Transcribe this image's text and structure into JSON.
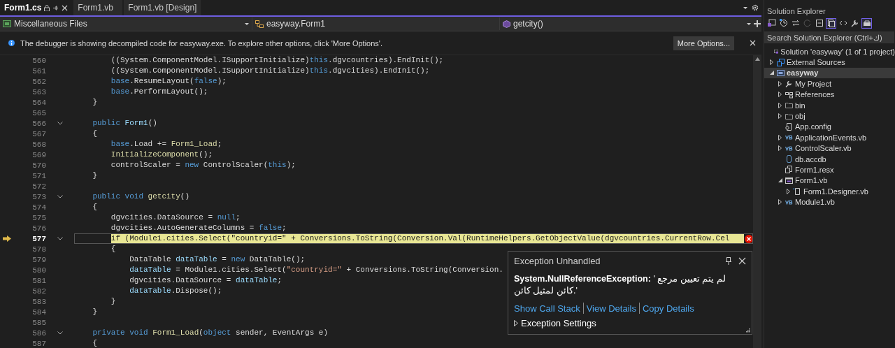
{
  "tabs": [
    {
      "label": "Form1.cs",
      "selected": true
    },
    {
      "label": "Form1.vb",
      "selected": false
    },
    {
      "label": "Form1.vb [Design]",
      "selected": false
    }
  ],
  "navigation_bar": {
    "project": "Miscellaneous Files",
    "type": "easyway.Form1",
    "member": "getcity()"
  },
  "info_bar": {
    "message": "The debugger is showing decompiled code for easyway.exe. To explore other options, click 'More Options'.",
    "button": "More Options..."
  },
  "editor": {
    "lines": [
      {
        "number": "560",
        "fold": false,
        "current": false,
        "error": false,
        "segments": [
          {
            "kind": "plain",
            "text": "        ((System.ComponentModel.ISupportInitialize)"
          },
          {
            "kind": "keyword",
            "text": "this"
          },
          {
            "kind": "plain",
            "text": ".dgvcountries).EndInit();"
          }
        ]
      },
      {
        "number": "561",
        "fold": false,
        "current": false,
        "error": false,
        "segments": [
          {
            "kind": "plain",
            "text": "        ((System.ComponentModel.ISupportInitialize)"
          },
          {
            "kind": "keyword",
            "text": "this"
          },
          {
            "kind": "plain",
            "text": ".dgvcities).EndInit();"
          }
        ]
      },
      {
        "number": "562",
        "fold": false,
        "current": false,
        "error": false,
        "segments": [
          {
            "kind": "keyword",
            "text": "        base"
          },
          {
            "kind": "plain",
            "text": ".ResumeLayout("
          },
          {
            "kind": "keyword",
            "text": "false"
          },
          {
            "kind": "plain",
            "text": ");"
          }
        ]
      },
      {
        "number": "563",
        "fold": false,
        "current": false,
        "error": false,
        "segments": [
          {
            "kind": "keyword",
            "text": "        base"
          },
          {
            "kind": "plain",
            "text": ".PerformLayout();"
          }
        ]
      },
      {
        "number": "564",
        "fold": false,
        "current": false,
        "error": false,
        "segments": [
          {
            "kind": "plain",
            "text": "    }"
          }
        ]
      },
      {
        "number": "565",
        "fold": false,
        "current": false,
        "error": false
      },
      {
        "number": "566",
        "fold": true,
        "current": false,
        "error": false,
        "segments": [
          {
            "kind": "keyword",
            "text": "    public "
          },
          {
            "kind": "local",
            "text": "Form1"
          },
          {
            "kind": "plain",
            "text": "()"
          }
        ]
      },
      {
        "number": "567",
        "fold": false,
        "current": false,
        "error": false,
        "segments": [
          {
            "kind": "plain",
            "text": "    {"
          }
        ]
      },
      {
        "number": "568",
        "fold": false,
        "current": false,
        "error": false,
        "segments": [
          {
            "kind": "keyword",
            "text": "        base"
          },
          {
            "kind": "plain",
            "text": ".Load += "
          },
          {
            "kind": "method",
            "text": "Form1_Load"
          },
          {
            "kind": "plain",
            "text": ";"
          }
        ]
      },
      {
        "number": "569",
        "fold": false,
        "current": false,
        "error": false,
        "segments": [
          {
            "kind": "method",
            "text": "        InitializeComponent"
          },
          {
            "kind": "plain",
            "text": "();"
          }
        ]
      },
      {
        "number": "570",
        "fold": false,
        "current": false,
        "error": false,
        "segments": [
          {
            "kind": "plain",
            "text": "        controlScaler = "
          },
          {
            "kind": "keyword",
            "text": "new"
          },
          {
            "kind": "plain",
            "text": " ControlScaler("
          },
          {
            "kind": "keyword",
            "text": "this"
          },
          {
            "kind": "plain",
            "text": ");"
          }
        ]
      },
      {
        "number": "571",
        "fold": false,
        "current": false,
        "error": false,
        "segments": [
          {
            "kind": "plain",
            "text": "    }"
          }
        ]
      },
      {
        "number": "572",
        "fold": false,
        "current": false,
        "error": false
      },
      {
        "number": "573",
        "fold": true,
        "current": false,
        "error": false,
        "segments": [
          {
            "kind": "keyword",
            "text": "    public void "
          },
          {
            "kind": "method",
            "text": "getcity"
          },
          {
            "kind": "plain",
            "text": "()"
          }
        ]
      },
      {
        "number": "574",
        "fold": false,
        "current": false,
        "error": false,
        "segments": [
          {
            "kind": "plain",
            "text": "    {"
          }
        ]
      },
      {
        "number": "575",
        "fold": false,
        "current": false,
        "error": false,
        "segments": [
          {
            "kind": "plain",
            "text": "        dgvcities.DataSource = "
          },
          {
            "kind": "keyword",
            "text": "null"
          },
          {
            "kind": "plain",
            "text": ";"
          }
        ]
      },
      {
        "number": "576",
        "fold": false,
        "current": false,
        "error": false,
        "segments": [
          {
            "kind": "plain",
            "text": "        dgvcities.AutoGenerateColumns = "
          },
          {
            "kind": "keyword",
            "text": "false"
          },
          {
            "kind": "plain",
            "text": ";"
          }
        ]
      },
      {
        "number": "577",
        "fold": true,
        "current": true,
        "error": true,
        "segments": [
          {
            "kind": "plain",
            "text": "        if (Module1.cities.Select(\"countryid=\" + Conversions.ToString(Conversion.Val(RuntimeHelpers.GetObjectValue(dgvcountries.CurrentRow.Cel"
          }
        ]
      },
      {
        "number": "578",
        "fold": false,
        "current": false,
        "error": false,
        "segments": [
          {
            "kind": "plain",
            "text": "        {"
          }
        ]
      },
      {
        "number": "579",
        "fold": false,
        "current": false,
        "error": false,
        "segments": [
          {
            "kind": "plain",
            "text": "            DataTable "
          },
          {
            "kind": "local",
            "text": "dataTable"
          },
          {
            "kind": "plain",
            "text": " = "
          },
          {
            "kind": "keyword",
            "text": "new"
          },
          {
            "kind": "plain",
            "text": " DataTable();"
          }
        ]
      },
      {
        "number": "580",
        "fold": false,
        "current": false,
        "error": false,
        "segments": [
          {
            "kind": "local",
            "text": "            dataTable"
          },
          {
            "kind": "plain",
            "text": " = Module1.cities.Select("
          },
          {
            "kind": "string",
            "text": "\"countryid=\""
          },
          {
            "kind": "plain",
            "text": " + Conversions.ToString(Conversion."
          }
        ]
      },
      {
        "number": "581",
        "fold": false,
        "current": false,
        "error": false,
        "segments": [
          {
            "kind": "plain",
            "text": "            dgvcities.DataSource = "
          },
          {
            "kind": "local",
            "text": "dataTable"
          },
          {
            "kind": "plain",
            "text": ";"
          }
        ]
      },
      {
        "number": "582",
        "fold": false,
        "current": false,
        "error": false,
        "segments": [
          {
            "kind": "local",
            "text": "            dataTable"
          },
          {
            "kind": "plain",
            "text": ".Dispose();"
          }
        ]
      },
      {
        "number": "583",
        "fold": false,
        "current": false,
        "error": false,
        "segments": [
          {
            "kind": "plain",
            "text": "        }"
          }
        ]
      },
      {
        "number": "584",
        "fold": false,
        "current": false,
        "error": false,
        "segments": [
          {
            "kind": "plain",
            "text": "    }"
          }
        ]
      },
      {
        "number": "585",
        "fold": false,
        "current": false,
        "error": false
      },
      {
        "number": "586",
        "fold": true,
        "current": false,
        "error": false,
        "segments": [
          {
            "kind": "keyword",
            "text": "    private void "
          },
          {
            "kind": "method",
            "text": "Form1_Load"
          },
          {
            "kind": "plain",
            "text": "("
          },
          {
            "kind": "keyword",
            "text": "object"
          },
          {
            "kind": "plain",
            "text": " sender, EventArgs e)"
          }
        ]
      },
      {
        "number": "587",
        "fold": false,
        "current": false,
        "error": false,
        "segments": [
          {
            "kind": "plain",
            "text": "    {"
          }
        ]
      }
    ]
  },
  "exception": {
    "title": "Exception Unhandled",
    "message": "**System.NullReferenceException:** ' لم يتم تعيين مرجع كائن لمثيل كائن.'",
    "links": [
      "Show Call Stack",
      "View Details",
      "Copy Details"
    ],
    "settings": "Exception Settings"
  },
  "solution_explorer": {
    "title": "Solution Explorer",
    "toolbar": [
      {
        "kind": "solution",
        "on": false
      },
      {
        "kind": "history",
        "on": false
      },
      {
        "kind": "sync",
        "on": false
      },
      {
        "kind": "refresh",
        "on": false
      },
      {
        "kind": "collapse",
        "on": false
      },
      {
        "kind": "files",
        "on": true
      },
      {
        "kind": "code",
        "on": false
      },
      {
        "kind": "wrench",
        "on": false
      },
      {
        "kind": "preview",
        "on": true
      }
    ],
    "search": {
      "placeholder": "Search Solution Explorer (Ctrl+ك)"
    },
    "tree": [
      {
        "label": "Solution 'easyway' (1 of 1 project)",
        "kind": "solution",
        "expandable": false,
        "selected": false
      },
      {
        "label": "External Sources",
        "kind": "external",
        "expandable": true,
        "expanded": false,
        "selected": false
      },
      {
        "label": "easyway",
        "kind": "project",
        "expandable": true,
        "expanded": true,
        "selected": true,
        "children": [
          {
            "label": "My Project",
            "kind": "wrench",
            "expandable": true,
            "expanded": false,
            "selected": false
          },
          {
            "label": "References",
            "kind": "references",
            "expandable": true,
            "expanded": false,
            "selected": false
          },
          {
            "label": "bin",
            "kind": "folder",
            "expandable": true,
            "expanded": false,
            "selected": false
          },
          {
            "label": "obj",
            "kind": "folder",
            "expandable": true,
            "expanded": false,
            "selected": false
          },
          {
            "label": "App.config",
            "kind": "config",
            "expandable": false,
            "selected": false
          },
          {
            "label": "ApplicationEvents.vb",
            "kind": "vb",
            "expandable": true,
            "expanded": false,
            "selected": false
          },
          {
            "label": "ControlScaler.vb",
            "kind": "vb",
            "expandable": true,
            "expanded": false,
            "selected": false
          },
          {
            "label": "db.accdb",
            "kind": "database",
            "expandable": false,
            "selected": false
          },
          {
            "label": "Form1.resx",
            "kind": "resx",
            "expandable": false,
            "selected": false
          },
          {
            "label": "Form1.vb",
            "kind": "form",
            "expandable": true,
            "expanded": true,
            "selected": false,
            "children": [
              {
                "label": "Form1.Designer.vb",
                "kind": "designer",
                "expandable": true,
                "expanded": false,
                "selected": false
              }
            ]
          },
          {
            "label": "Module1.vb",
            "kind": "vb",
            "expandable": true,
            "expanded": false,
            "selected": false
          }
        ]
      }
    ]
  }
}
